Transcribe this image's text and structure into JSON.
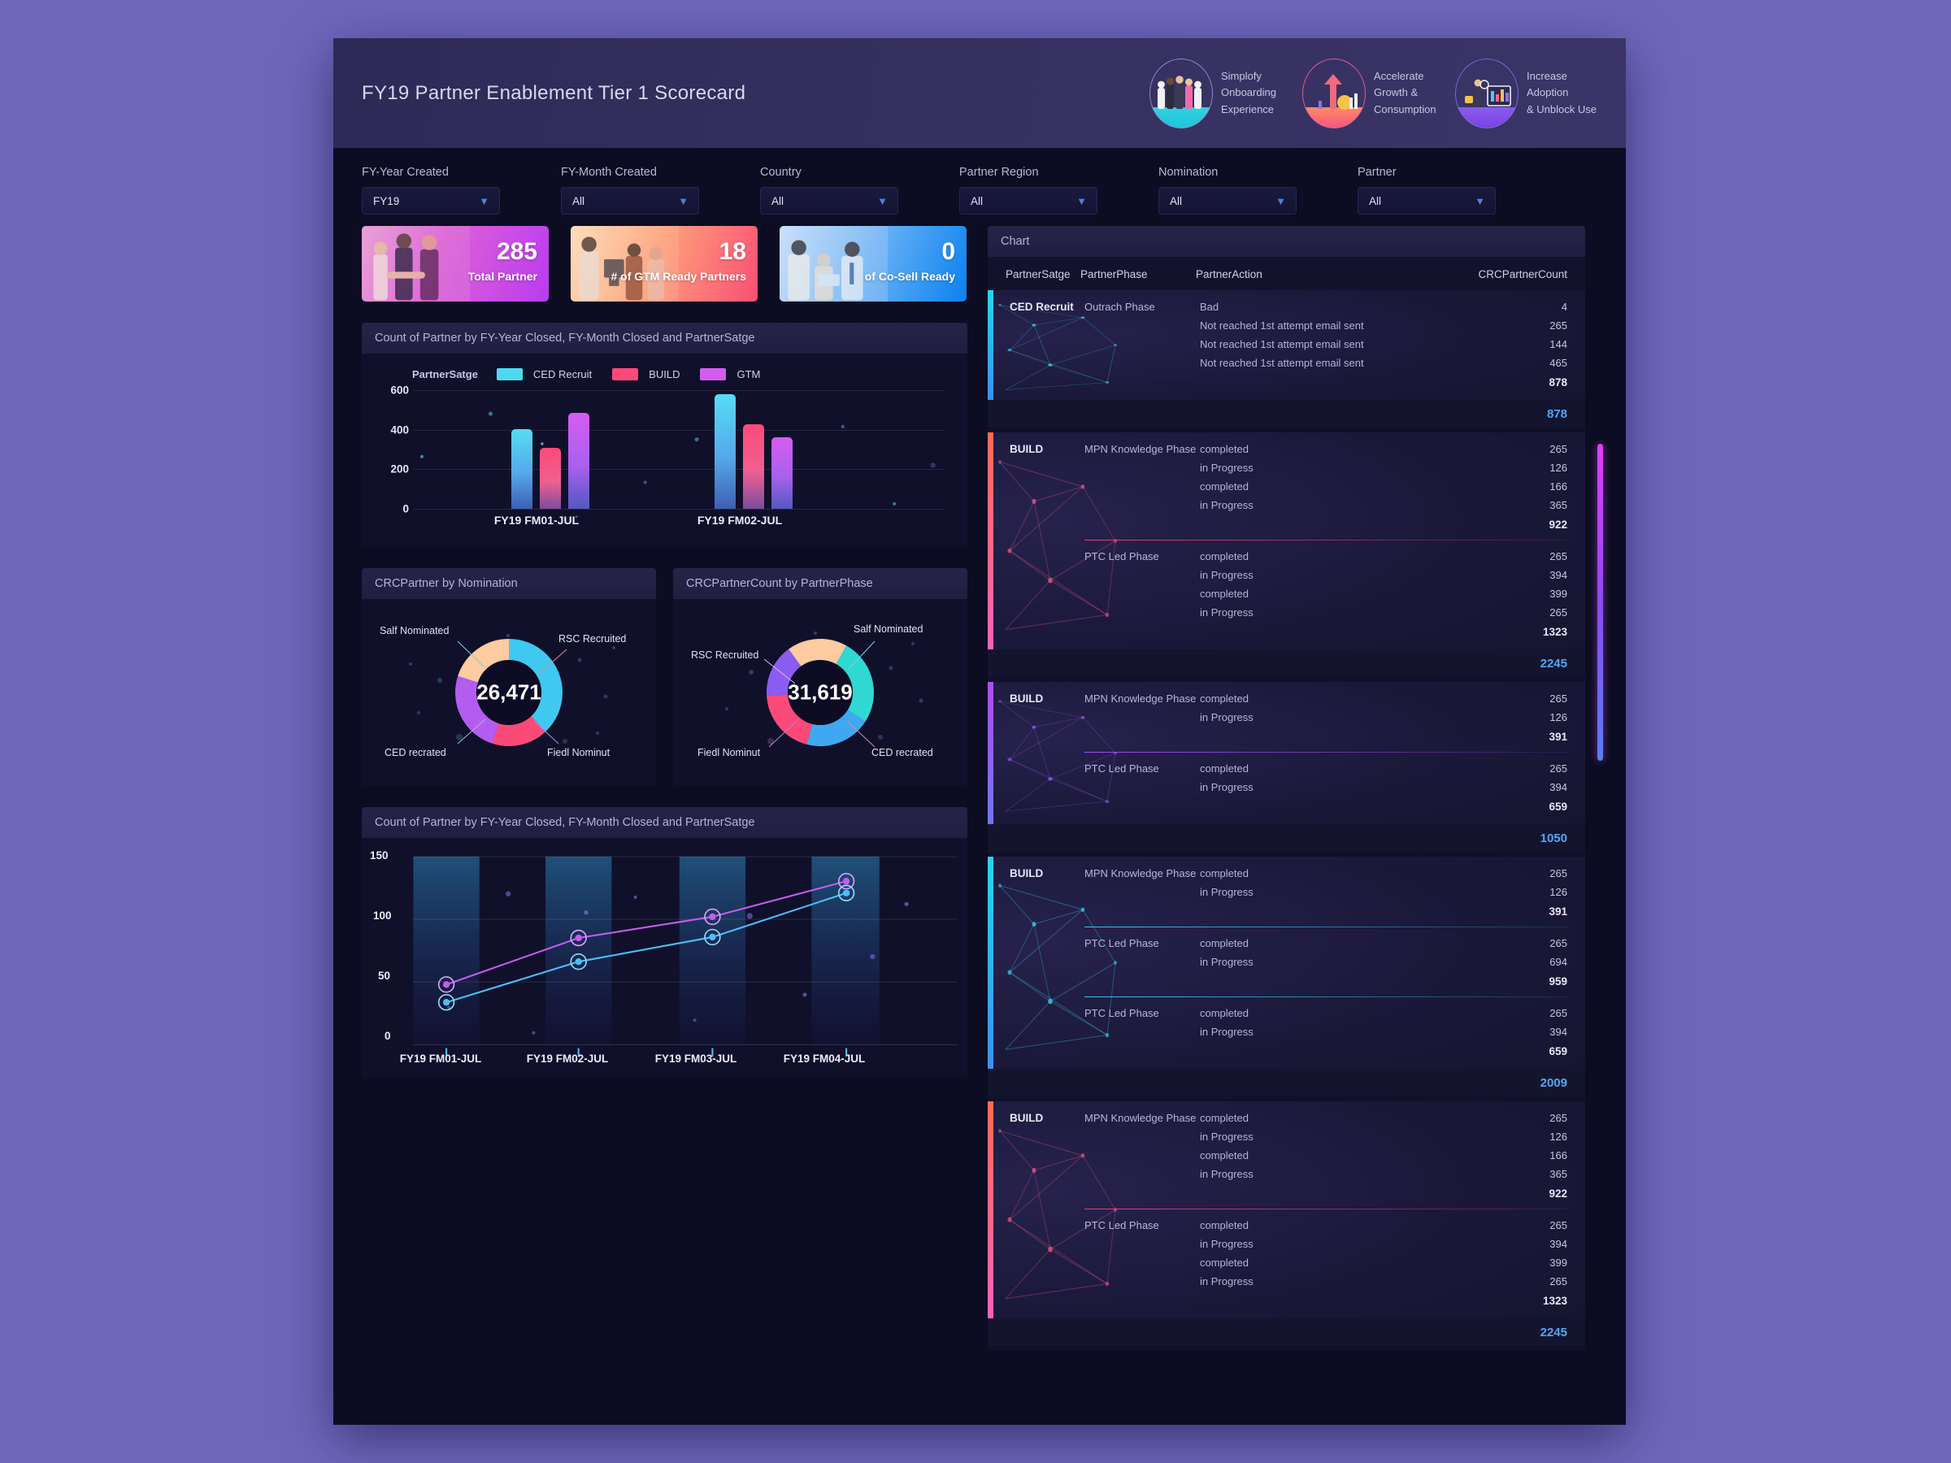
{
  "header": {
    "title": "FY19 Partner Enablement Tier 1 Scorecard",
    "badges": [
      {
        "icon": "people-group-icon",
        "line1": "Simplofy",
        "line2": "Onboarding",
        "line3": "Experience"
      },
      {
        "icon": "growth-arrow-icon",
        "line1": "Accelerate",
        "line2": "Growth &",
        "line3": "Consumption"
      },
      {
        "icon": "adoption-dashboard-icon",
        "line1": "Increase",
        "line2": "Adoption",
        "line3": "& Unblock Use"
      }
    ]
  },
  "filters": [
    {
      "label": "FY-Year Created",
      "value": "FY19"
    },
    {
      "label": "FY-Month Created",
      "value": "All"
    },
    {
      "label": "Country",
      "value": "All"
    },
    {
      "label": "Partner Region",
      "value": "All"
    },
    {
      "label": "Nomination",
      "value": "All"
    },
    {
      "label": "Partner",
      "value": "All"
    }
  ],
  "kpis": [
    {
      "value": "285",
      "label": "Total Partner"
    },
    {
      "value": "18",
      "label": "# of GTM Ready Partners"
    },
    {
      "value": "0",
      "label": "of Co-Sell Ready"
    }
  ],
  "panels": {
    "bar_title": "Count of Partner by FY-Year Closed, FY-Month Closed and PartnerSatge",
    "donut1_title": "CRCPartner by Nomination",
    "donut2_title": "CRCPartnerCount by PartnerPhase",
    "line_title": "Count of Partner by FY-Year Closed, FY-Month Closed and PartnerSatge",
    "chart_title": "Chart"
  },
  "table": {
    "columns": [
      "PartnerSatge",
      "PartnerPhase",
      "PartnerAction",
      "CRCPartnerCount"
    ],
    "groups": [
      {
        "stage": "CED Recruit",
        "accent": "a-cyan",
        "divider": "d-cyan",
        "net": "cyan",
        "phases": [
          {
            "phase": "Outrach Phase",
            "actions": [
              {
                "label": "Bad",
                "value": "4"
              },
              {
                "label": "Not reached 1st attempt email sent",
                "value": "265"
              },
              {
                "label": "Not reached 1st attempt email sent",
                "value": "144"
              },
              {
                "label": "Not reached 1st attempt email sent",
                "value": "465"
              }
            ],
            "subtotal": "878"
          }
        ],
        "total": "878"
      },
      {
        "stage": "BUILD",
        "accent": "a-orange",
        "divider": "d-pink",
        "net": "pink",
        "phases": [
          {
            "phase": "MPN Knowledge Phase",
            "actions": [
              {
                "label": "completed",
                "value": "265"
              },
              {
                "label": "in Progress",
                "value": "126"
              },
              {
                "label": "completed",
                "value": "166"
              },
              {
                "label": "in Progress",
                "value": "365"
              }
            ],
            "subtotal": "922"
          },
          {
            "phase": "PTC Led Phase",
            "actions": [
              {
                "label": "completed",
                "value": "265"
              },
              {
                "label": "in Progress",
                "value": "394"
              },
              {
                "label": "completed",
                "value": "399"
              },
              {
                "label": "in Progress",
                "value": "265"
              }
            ],
            "subtotal": "1323"
          }
        ],
        "total": "2245"
      },
      {
        "stage": "BUILD",
        "accent": "a-violet",
        "divider": "d-violet",
        "net": "violet",
        "phases": [
          {
            "phase": "MPN Knowledge Phase",
            "actions": [
              {
                "label": "completed",
                "value": "265"
              },
              {
                "label": "in Progress",
                "value": "126"
              }
            ],
            "subtotal": "391"
          },
          {
            "phase": "PTC Led Phase",
            "actions": [
              {
                "label": "completed",
                "value": "265"
              },
              {
                "label": "in Progress",
                "value": "394"
              }
            ],
            "subtotal": "659"
          }
        ],
        "total": "1050"
      },
      {
        "stage": "BUILD",
        "accent": "a-cyan",
        "divider": "d-cyan",
        "net": "cyan",
        "phases": [
          {
            "phase": "MPN Knowledge Phase",
            "actions": [
              {
                "label": "completed",
                "value": "265"
              },
              {
                "label": "in Progress",
                "value": "126"
              }
            ],
            "subtotal": "391"
          },
          {
            "phase": "PTC Led Phase",
            "actions": [
              {
                "label": "completed",
                "value": "265"
              },
              {
                "label": "in Progress",
                "value": "694"
              }
            ],
            "subtotal": "959"
          },
          {
            "phase": "PTC Led Phase",
            "actions": [
              {
                "label": "completed",
                "value": "265"
              },
              {
                "label": "in Progress",
                "value": "394"
              }
            ],
            "subtotal": "659"
          }
        ],
        "total": "2009"
      },
      {
        "stage": "BUILD",
        "accent": "a-orange",
        "divider": "d-pink",
        "net": "pink",
        "phases": [
          {
            "phase": "MPN Knowledge Phase",
            "actions": [
              {
                "label": "completed",
                "value": "265"
              },
              {
                "label": "in Progress",
                "value": "126"
              },
              {
                "label": "completed",
                "value": "166"
              },
              {
                "label": "in Progress",
                "value": "365"
              }
            ],
            "subtotal": "922"
          },
          {
            "phase": "PTC Led Phase",
            "actions": [
              {
                "label": "completed",
                "value": "265"
              },
              {
                "label": "in Progress",
                "value": "394"
              },
              {
                "label": "completed",
                "value": "399"
              },
              {
                "label": "in Progress",
                "value": "265"
              }
            ],
            "subtotal": "1323"
          }
        ],
        "total": "2245"
      }
    ]
  },
  "chart_data": [
    {
      "type": "bar",
      "title": "Count of Partner by FY-Year Closed, FY-Month Closed and PartnerSatge",
      "legend_title": "PartnerSatge",
      "legend_position": "top-left",
      "categories": [
        "FY19 FM01-JUL",
        "FY19 FM02-JUL"
      ],
      "series": [
        {
          "name": "CED Recruit",
          "color": "#4DD9F0",
          "values": [
            425,
            610
          ]
        },
        {
          "name": "BUILD",
          "color": "#FB4A78",
          "values": [
            325,
            450
          ]
        },
        {
          "name": "GTM",
          "color": "#D65CF0",
          "values": [
            510,
            380
          ]
        }
      ],
      "xlabel": "",
      "ylabel": "",
      "ylim": [
        0,
        650
      ],
      "yticks": [
        0,
        200,
        400,
        600
      ],
      "grid": true
    },
    {
      "type": "pie",
      "title": "CRCPartner by Nomination",
      "center_label": "26,471",
      "labels": [
        "Salf Nominated",
        "RSC Recruited",
        "Fiedl Nominut",
        "CED recrated"
      ],
      "values": [
        38,
        17,
        25,
        20
      ],
      "colors": [
        "#3FC8F0",
        "#FB4A78",
        "#B45CF0",
        "#FFCBA0"
      ],
      "legend_position": "callout"
    },
    {
      "type": "pie",
      "title": "CRCPartnerCount by PartnerPhase",
      "center_label": "31,619",
      "labels": [
        "Salf Nominated",
        "CED recrated",
        "Fiedl Nominut",
        "RSC Recruited"
      ],
      "values": [
        34,
        20,
        22,
        24
      ],
      "colors": [
        "#2FD8D0",
        "#FB4A78",
        "#8B5CF0",
        "#FFCBA0"
      ],
      "legend_position": "callout"
    },
    {
      "type": "line",
      "title": "Count of Partner by FY-Year Closed, FY-Month Closed and PartnerSatge",
      "categories": [
        "FY19 FM01-JUL",
        "FY19 FM02-JUL",
        "FY19 FM03-JUL",
        "FY19 FM04-JUL"
      ],
      "series": [
        {
          "name": "series-violet",
          "color": "#C45CF0",
          "values": [
            48,
            85,
            102,
            131
          ]
        },
        {
          "name": "series-cyan",
          "color": "#4DBFF5",
          "values": [
            34,
            66,
            86,
            121
          ]
        }
      ],
      "xlabel": "",
      "ylabel": "",
      "ylim": [
        0,
        155
      ],
      "yticks": [
        0,
        50,
        100,
        150
      ],
      "grid": true
    }
  ]
}
